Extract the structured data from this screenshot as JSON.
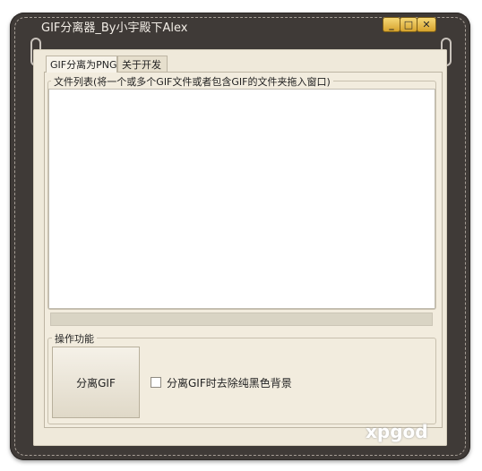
{
  "window": {
    "title": "GIF分离器_By小宇殿下Alex",
    "controls": {
      "minimize": "_",
      "maximize": "□",
      "close": "✕"
    }
  },
  "tabs": [
    {
      "label": "GIF分离为PNG",
      "active": true
    },
    {
      "label": "关于开发",
      "active": false
    }
  ],
  "file_list": {
    "group_title": "文件列表(将一个或多个GIF文件或者包含GIF的文件夹拖入窗口)",
    "items": []
  },
  "progress": {
    "value": 0
  },
  "operations": {
    "group_title": "操作功能",
    "split_button": "分离GIF",
    "remove_black_bg_checkbox": {
      "label": "分离GIF时去除纯黑色背景",
      "checked": false
    }
  },
  "watermark": {
    "text": "xpgod"
  },
  "colors": {
    "frame": "#3f3a37",
    "paper": "#efe9da",
    "accent": "#d6a32d"
  }
}
